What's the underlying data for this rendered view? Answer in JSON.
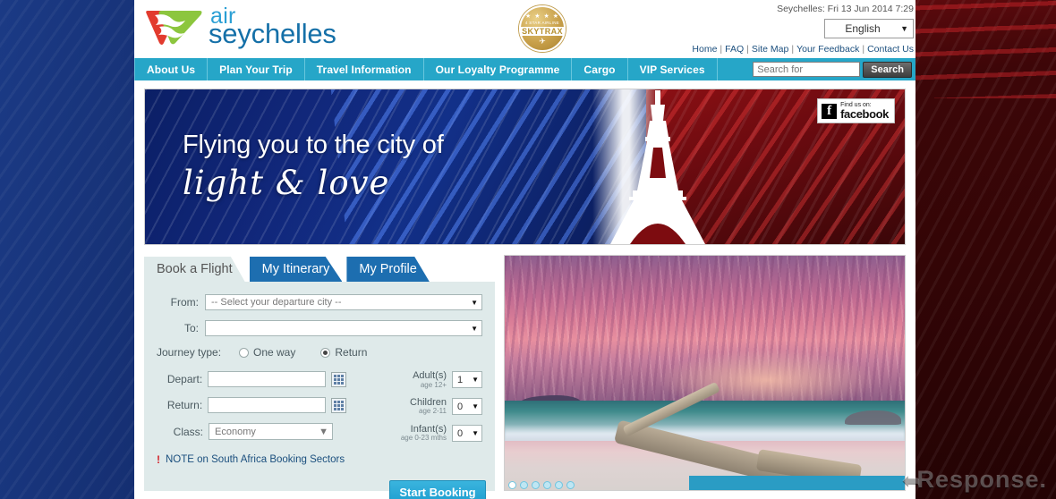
{
  "site": {
    "brand_line1": "air",
    "brand_line2": "seychelles",
    "skytrax": {
      "stars": "★ ★ ★ ★",
      "caption": "4 STAR AIRLINE",
      "brand": "SKYTRAX",
      "wing": "✈"
    }
  },
  "header": {
    "datetime": "Seychelles: Fri 13 Jun 2014 7:29",
    "language_selected": "English",
    "language_options": [
      "English"
    ],
    "toplinks": [
      "Home",
      "FAQ",
      "Site Map",
      "Your Feedback",
      "Contact Us"
    ],
    "link_separator": "|"
  },
  "nav": {
    "items": [
      "About Us",
      "Plan Your Trip",
      "Travel Information",
      "Our Loyalty Programme",
      "Cargo",
      "VIP Services"
    ],
    "search_placeholder": "Search for",
    "search_value": "",
    "search_button": "Search"
  },
  "hero": {
    "line1": "Flying you to the city of",
    "line2": "light & love",
    "facebook": {
      "find_us": "Find us on:",
      "name": "facebook",
      "glyph": "f"
    }
  },
  "booking": {
    "tabs": [
      {
        "label": "Book a Flight",
        "active": true
      },
      {
        "label": "My Itinerary",
        "active": false
      },
      {
        "label": "My Profile",
        "active": false
      }
    ],
    "from_label": "From:",
    "from_value": "-- Select your departure city --",
    "to_label": "To:",
    "to_value": "",
    "journey_label": "Journey type:",
    "journey_options": [
      {
        "label": "One way",
        "selected": false
      },
      {
        "label": "Return",
        "selected": true
      }
    ],
    "depart_label": "Depart:",
    "depart_value": "",
    "return_label": "Return:",
    "return_value": "",
    "class_label": "Class:",
    "class_value": "Economy",
    "pax": [
      {
        "name": "Adult(s)",
        "age": "age 12+",
        "value": "1"
      },
      {
        "name": "Children",
        "age": "age 2-11",
        "value": "0"
      },
      {
        "name": "Infant(s)",
        "age": "age 0-23 mths",
        "value": "0"
      }
    ],
    "note_bang": "!",
    "note_text": "NOTE on South Africa Booking Sectors",
    "start_button": "Start Booking"
  },
  "photo": {
    "carousel_dots": 6,
    "active_dot": 1
  },
  "watermark": {
    "arrow": "➦",
    "text": "Response."
  },
  "colors": {
    "nav_teal": "#26a6c8",
    "tab_blue": "#1d6eb0",
    "form_bg": "#dfeaea",
    "link_blue": "#1b4f7e",
    "note_red": "#d3222a",
    "button_blue": "#2aa8d8",
    "logo_air": "#2a9fd4",
    "logo_seychelles": "#1570a8"
  }
}
